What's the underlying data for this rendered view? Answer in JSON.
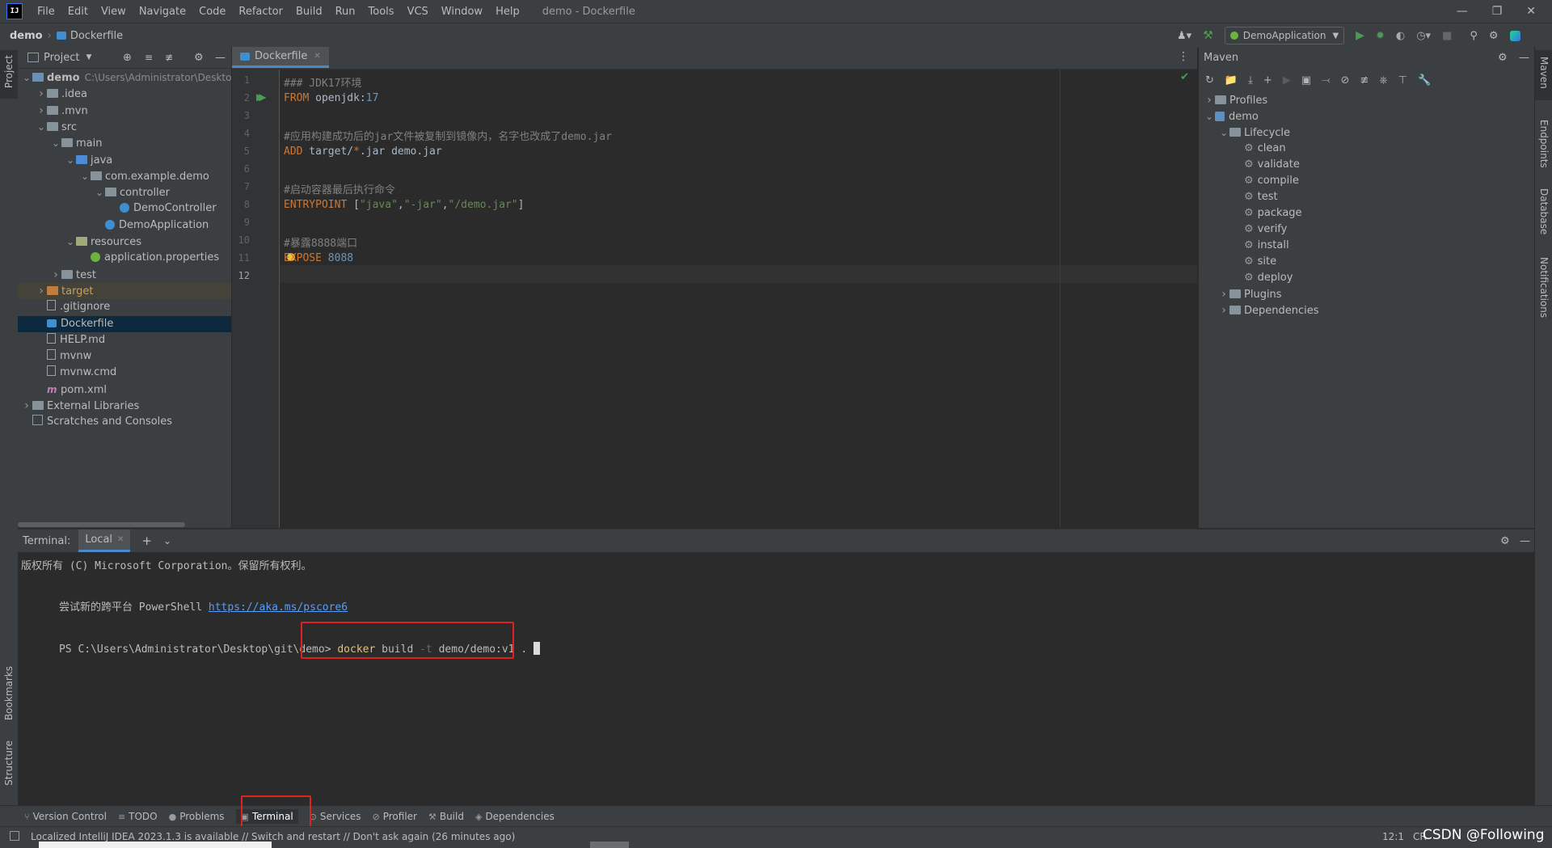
{
  "window": {
    "title": "demo - Dockerfile"
  },
  "menu": [
    "File",
    "Edit",
    "View",
    "Navigate",
    "Code",
    "Refactor",
    "Build",
    "Run",
    "Tools",
    "VCS",
    "Window",
    "Help"
  ],
  "breadcrumb": {
    "project": "demo",
    "file": "Dockerfile"
  },
  "run_config": "DemoApplication",
  "left_stripe": {
    "project": "Project",
    "bookmarks": "Bookmarks",
    "structure": "Structure"
  },
  "right_stripe": {
    "maven": "Maven",
    "endpoints": "Endpoints",
    "database": "Database",
    "notifications": "Notifications"
  },
  "project_panel": {
    "title": "Project",
    "tree": [
      {
        "label": "demo",
        "extra": "C:\\Users\\Administrator\\Desktop",
        "depth": 0,
        "open": true,
        "kind": "module",
        "bold": true
      },
      {
        "label": ".idea",
        "depth": 1,
        "open": false,
        "kind": "folder"
      },
      {
        "label": ".mvn",
        "depth": 1,
        "open": false,
        "kind": "folder"
      },
      {
        "label": "src",
        "depth": 1,
        "open": true,
        "kind": "folder"
      },
      {
        "label": "main",
        "depth": 2,
        "open": true,
        "kind": "folder"
      },
      {
        "label": "java",
        "depth": 3,
        "open": true,
        "kind": "src-folder"
      },
      {
        "label": "com.example.demo",
        "depth": 4,
        "open": true,
        "kind": "package"
      },
      {
        "label": "controller",
        "depth": 5,
        "open": true,
        "kind": "package"
      },
      {
        "label": "DemoController",
        "depth": 6,
        "kind": "class"
      },
      {
        "label": "DemoApplication",
        "depth": 5,
        "kind": "spring-class"
      },
      {
        "label": "resources",
        "depth": 3,
        "open": true,
        "kind": "res-folder"
      },
      {
        "label": "application.properties",
        "depth": 4,
        "kind": "props"
      },
      {
        "label": "test",
        "depth": 2,
        "open": false,
        "kind": "folder"
      },
      {
        "label": "target",
        "depth": 1,
        "open": false,
        "kind": "target"
      },
      {
        "label": ".gitignore",
        "depth": 1,
        "kind": "file"
      },
      {
        "label": "Dockerfile",
        "depth": 1,
        "kind": "docker",
        "selected": true
      },
      {
        "label": "HELP.md",
        "depth": 1,
        "kind": "md"
      },
      {
        "label": "mvnw",
        "depth": 1,
        "kind": "file"
      },
      {
        "label": "mvnw.cmd",
        "depth": 1,
        "kind": "file"
      },
      {
        "label": "pom.xml",
        "depth": 1,
        "kind": "maven"
      },
      {
        "label": "External Libraries",
        "depth": 0,
        "open": false,
        "kind": "libs"
      },
      {
        "label": "Scratches and Consoles",
        "depth": 0,
        "kind": "scratch"
      }
    ]
  },
  "editor": {
    "tab": "Dockerfile",
    "lines": [
      [
        [
          "c",
          "### JDK17环境"
        ]
      ],
      [
        [
          "k",
          "FROM"
        ],
        [
          "t",
          " openjdk:"
        ],
        [
          "n",
          "17"
        ]
      ],
      [],
      [
        [
          "c",
          "#应用构建成功后的jar文件被复制到镜像内，名字也改成了demo.jar"
        ]
      ],
      [
        [
          "k",
          "ADD"
        ],
        [
          "t",
          " target/"
        ],
        [
          "k",
          "*"
        ],
        [
          "t",
          ".jar demo.jar"
        ]
      ],
      [],
      [
        [
          "c",
          "#启动容器最后执行命令"
        ]
      ],
      [
        [
          "k",
          "ENTRYPOINT"
        ],
        [
          "t",
          " ["
        ],
        [
          "s",
          "\"java\""
        ],
        [
          "t",
          ","
        ],
        [
          "s",
          "\"-jar\""
        ],
        [
          "t",
          ","
        ],
        [
          "s",
          "\"/demo.jar\""
        ],
        [
          "t",
          "]"
        ]
      ],
      [],
      [
        [
          "c",
          "#暴露8888端口"
        ]
      ],
      [
        [
          "k",
          "EXPOSE"
        ],
        [
          "t",
          " "
        ],
        [
          "n",
          "8088"
        ]
      ],
      []
    ],
    "line_numbers": [
      "1",
      "2",
      "3",
      "4",
      "5",
      "6",
      "7",
      "8",
      "9",
      "10",
      "11",
      "12"
    ]
  },
  "maven": {
    "title": "Maven",
    "tree": [
      {
        "label": "Profiles",
        "depth": 0,
        "kind": "folder",
        "chev": "closed"
      },
      {
        "label": "demo",
        "depth": 0,
        "kind": "module",
        "chev": "open"
      },
      {
        "label": "Lifecycle",
        "depth": 1,
        "kind": "folder",
        "chev": "open"
      },
      {
        "label": "clean",
        "depth": 2,
        "kind": "gear"
      },
      {
        "label": "validate",
        "depth": 2,
        "kind": "gear"
      },
      {
        "label": "compile",
        "depth": 2,
        "kind": "gear"
      },
      {
        "label": "test",
        "depth": 2,
        "kind": "gear"
      },
      {
        "label": "package",
        "depth": 2,
        "kind": "gear"
      },
      {
        "label": "verify",
        "depth": 2,
        "kind": "gear"
      },
      {
        "label": "install",
        "depth": 2,
        "kind": "gear"
      },
      {
        "label": "site",
        "depth": 2,
        "kind": "gear"
      },
      {
        "label": "deploy",
        "depth": 2,
        "kind": "gear"
      },
      {
        "label": "Plugins",
        "depth": 1,
        "kind": "folder",
        "chev": "closed"
      },
      {
        "label": "Dependencies",
        "depth": 1,
        "kind": "folder",
        "chev": "closed"
      }
    ]
  },
  "terminal": {
    "label": "Terminal:",
    "tab": "Local",
    "copyright": "版权所有 (C) Microsoft Corporation。保留所有权利。",
    "try_prefix": "尝试新的跨平台 PowerShell ",
    "try_link": "https://aka.ms/pscore6",
    "prompt": "PS C:\\Users\\Administrator\\Desktop\\git\\demo> ",
    "cmd_docker": "docker",
    "cmd_build": " build ",
    "cmd_flag": "-t",
    "cmd_rest": " demo/demo:v1 ."
  },
  "tool_windows": [
    "Version Control",
    "TODO",
    "Problems",
    "Terminal",
    "Services",
    "Profiler",
    "Build",
    "Dependencies"
  ],
  "status": {
    "message": "Localized IntelliJ IDEA 2023.1.3 is available // Switch and restart // Don't ask again (26 minutes ago)",
    "position": "12:1",
    "encoding": "CR",
    "watermark": "CSDN @Following"
  },
  "colors": {
    "keyword": "#cc7832",
    "comment": "#808080",
    "number": "#6897bb",
    "string": "#6a8759",
    "text": "#a9b7c6",
    "link": "#589df6",
    "highlight": "#e0231d"
  }
}
